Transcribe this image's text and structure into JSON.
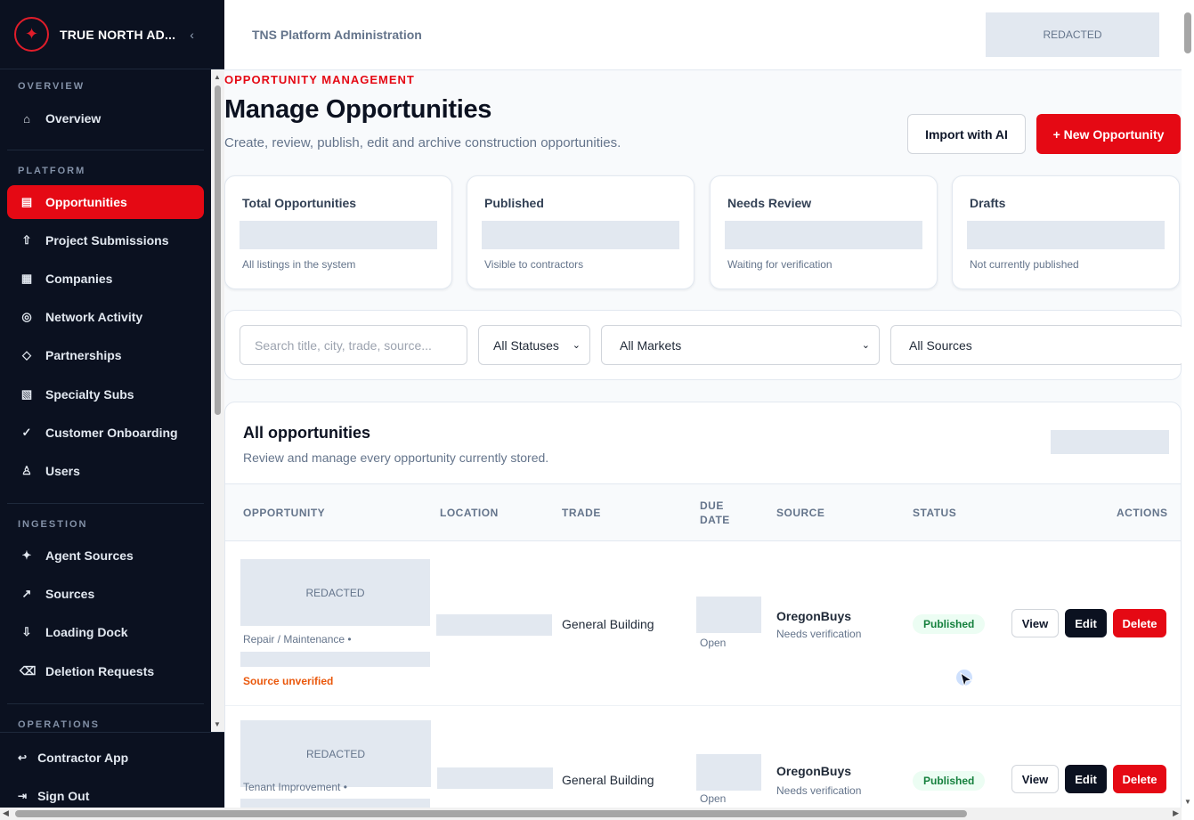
{
  "sidebar": {
    "brand": "TRUE NORTH AD...",
    "collapse_glyph": "‹",
    "sections": {
      "overview": "OVERVIEW",
      "platform": "PLATFORM",
      "ingestion": "INGESTION",
      "operations": "OPERATIONS"
    },
    "items": [
      {
        "label": "Overview",
        "icon": "home-icon",
        "glyph": "⌂"
      },
      {
        "label": "Opportunities",
        "icon": "list-icon",
        "glyph": "▤",
        "active": true
      },
      {
        "label": "Project Submissions",
        "icon": "upload-icon",
        "glyph": "⇧"
      },
      {
        "label": "Companies",
        "icon": "building-icon",
        "glyph": "▦"
      },
      {
        "label": "Network Activity",
        "icon": "target-icon",
        "glyph": "◎"
      },
      {
        "label": "Partnerships",
        "icon": "diamond-icon",
        "glyph": "◇"
      },
      {
        "label": "Specialty Subs",
        "icon": "grid-icon",
        "glyph": "▧"
      },
      {
        "label": "Customer Onboarding",
        "icon": "check-icon",
        "glyph": "✓"
      },
      {
        "label": "Users",
        "icon": "user-icon",
        "glyph": "♙"
      },
      {
        "label": "Agent Sources",
        "icon": "sparkle-icon",
        "glyph": "✦"
      },
      {
        "label": "Sources",
        "icon": "arrow-up-right-icon",
        "glyph": "↗"
      },
      {
        "label": "Loading Dock",
        "icon": "download-icon",
        "glyph": "⇩"
      },
      {
        "label": "Deletion Requests",
        "icon": "erase-icon",
        "glyph": "⌫"
      }
    ],
    "footer": [
      {
        "label": "Contractor App",
        "icon": "return-icon",
        "glyph": "↩"
      },
      {
        "label": "Sign Out",
        "icon": "sign-out-icon",
        "glyph": "⇥"
      }
    ]
  },
  "topbar": {
    "title": "TNS Platform Administration",
    "redacted": "REDACTED"
  },
  "header": {
    "eyebrow": "OPPORTUNITY MANAGEMENT",
    "title": "Manage Opportunities",
    "subtitle": "Create, review, publish, edit and archive construction opportunities.",
    "import_label": "Import with AI",
    "new_label": "+ New Opportunity"
  },
  "stats": [
    {
      "label": "Total Opportunities",
      "hint": "All listings in the system"
    },
    {
      "label": "Published",
      "hint": "Visible to contractors"
    },
    {
      "label": "Needs Review",
      "hint": "Waiting for verification"
    },
    {
      "label": "Drafts",
      "hint": "Not currently published"
    }
  ],
  "filters": {
    "search_placeholder": "Search title, city, trade, source...",
    "status": "All Statuses",
    "market": "All Markets",
    "source": "All Sources"
  },
  "table": {
    "title": "All opportunities",
    "subtitle": "Review and manage every opportunity currently stored.",
    "columns": {
      "opportunity": "OPPORTUNITY",
      "location": "LOCATION",
      "trade": "TRADE",
      "due_1": "DUE",
      "due_2": "DATE",
      "source": "SOURCE",
      "status": "STATUS",
      "actions": "ACTIONS"
    },
    "rows": [
      {
        "image": "REDACTED",
        "category": "Repair / Maintenance  •",
        "warning": "Source unverified",
        "trade": "General Building",
        "due_status": "Open",
        "source": "OregonBuys",
        "source_note": "Needs verification",
        "status": "Published",
        "view": "View",
        "edit": "Edit",
        "delete": "Delete"
      },
      {
        "image": "REDACTED",
        "category": "Tenant Improvement  •",
        "trade": "General Building",
        "due_status": "Open",
        "source": "OregonBuys",
        "source_note": "Needs verification",
        "status": "Published",
        "view": "View",
        "edit": "Edit",
        "delete": "Delete"
      }
    ]
  },
  "colors": {
    "accent": "#e50914",
    "sidebar_bg": "#0b1120",
    "published_badge_bg": "#ecfdf3",
    "published_badge_text": "#15803d",
    "warning_text": "#ea580c"
  }
}
